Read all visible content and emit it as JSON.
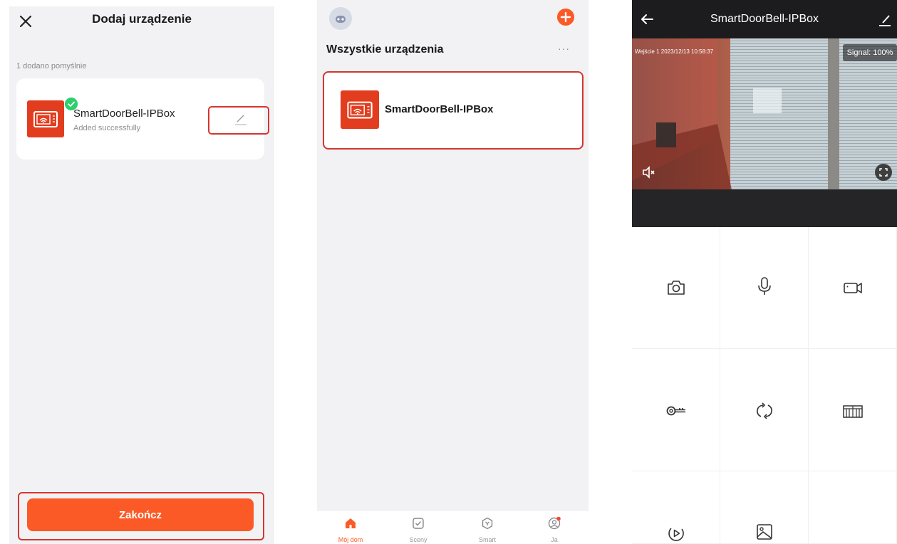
{
  "screen1": {
    "title": "Dodaj urządzenie",
    "count_text": "1 dodano pomyślnie",
    "device": {
      "name": "SmartDoorBell-IPBox",
      "status": "Added successfully"
    },
    "finish_label": "Zakończ"
  },
  "screen2": {
    "section_title": "Wszystkie urządzenia",
    "more": "···",
    "device": {
      "name": "SmartDoorBell-IPBox"
    },
    "tabs": [
      {
        "label": "Mój dom",
        "icon": "home-icon",
        "active": true
      },
      {
        "label": "Sceny",
        "icon": "scenes-icon",
        "active": false
      },
      {
        "label": "Smart",
        "icon": "smart-icon",
        "active": false
      },
      {
        "label": "Ja",
        "icon": "profile-icon",
        "active": false
      }
    ]
  },
  "screen3": {
    "title": "SmartDoorBell-IPBox",
    "osd": "Wejście 1 2023/12/13  10:58:37",
    "signal": "Signal: 100%",
    "controls": [
      {
        "name": "snapshot-icon"
      },
      {
        "name": "microphone-icon"
      },
      {
        "name": "record-video-icon"
      },
      {
        "name": "unlock-key-icon"
      },
      {
        "name": "switch-camera-icon"
      },
      {
        "name": "gate-icon"
      },
      {
        "name": "playback-icon"
      },
      {
        "name": "gallery-icon"
      }
    ]
  },
  "colors": {
    "accent": "#fb5a26",
    "highlight": "#d4362f",
    "device_red": "#e23d1e",
    "success": "#2fcf6e"
  }
}
